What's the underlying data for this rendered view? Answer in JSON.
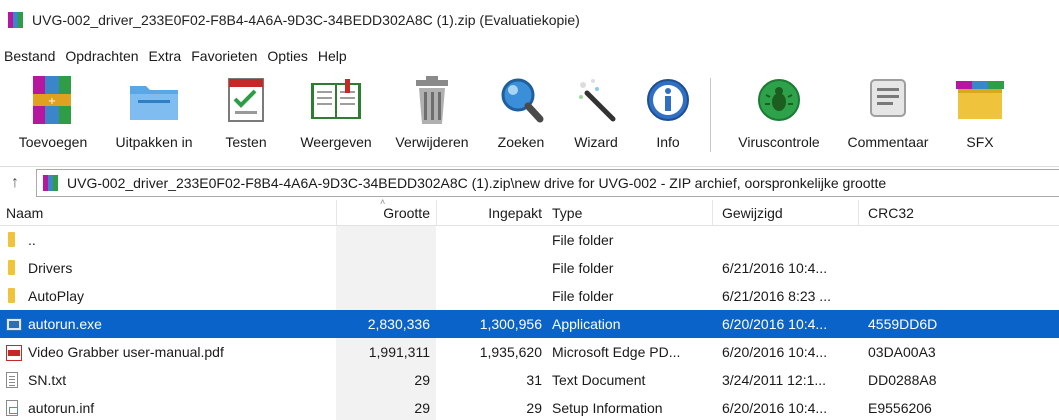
{
  "window": {
    "title": "UVG-002_driver_233E0F02-F8B4-4A6A-9D3C-34BEDD302A8C (1).zip (Evaluatiekopie)",
    "app_icon": "winrar-books-icon"
  },
  "menu": [
    "Bestand",
    "Opdrachten",
    "Extra",
    "Favorieten",
    "Opties",
    "Help"
  ],
  "toolbar": [
    {
      "label": "Toevoegen",
      "icon": "add-archive-icon"
    },
    {
      "label": "Uitpakken in",
      "icon": "extract-folder-icon"
    },
    {
      "label": "Testen",
      "icon": "test-checklist-icon"
    },
    {
      "label": "Weergeven",
      "icon": "view-book-icon"
    },
    {
      "label": "Verwijderen",
      "icon": "trash-bin-icon"
    },
    {
      "label": "Zoeken",
      "icon": "magnifier-icon"
    },
    {
      "label": "Wizard",
      "icon": "magic-wand-icon"
    },
    {
      "label": "Info",
      "icon": "info-icon"
    },
    {
      "label": "Viruscontrole",
      "icon": "virus-scan-icon"
    },
    {
      "label": "Commentaar",
      "icon": "comment-icon"
    },
    {
      "label": "SFX",
      "icon": "sfx-icon"
    }
  ],
  "address": {
    "up_icon": "up-arrow-icon",
    "path": "UVG-002_driver_233E0F02-F8B4-4A6A-9D3C-34BEDD302A8C (1).zip\\new drive for UVG-002 - ZIP archief, oorspronkelijke grootte"
  },
  "columns": {
    "name": "Naam",
    "size": "Grootte",
    "packed": "Ingepakt",
    "type": "Type",
    "modified": "Gewijzigd",
    "crc": "CRC32"
  },
  "files": [
    {
      "name": "..",
      "size": "",
      "packed": "",
      "type": "File folder",
      "modified": "",
      "crc": "",
      "icon": "folder-icon",
      "selected": false
    },
    {
      "name": "Drivers",
      "size": "",
      "packed": "",
      "type": "File folder",
      "modified": "6/21/2016 10:4...",
      "crc": "",
      "icon": "folder-icon",
      "selected": false
    },
    {
      "name": "AutoPlay",
      "size": "",
      "packed": "",
      "type": "File folder",
      "modified": "6/21/2016 8:23 ...",
      "crc": "",
      "icon": "folder-icon",
      "selected": false
    },
    {
      "name": "autorun.exe",
      "size": "2,830,336",
      "packed": "1,300,956",
      "type": "Application",
      "modified": "6/20/2016 10:4...",
      "crc": "4559DD6D",
      "icon": "exe-icon",
      "selected": true
    },
    {
      "name": "Video Grabber user-manual.pdf",
      "size": "1,991,311",
      "packed": "1,935,620",
      "type": "Microsoft Edge PD...",
      "modified": "6/20/2016 10:4...",
      "crc": "03DA00A3",
      "icon": "pdf-icon",
      "selected": false
    },
    {
      "name": "SN.txt",
      "size": "29",
      "packed": "31",
      "type": "Text Document",
      "modified": "3/24/2011 12:1...",
      "crc": "DD0288A8",
      "icon": "txt-icon",
      "selected": false
    },
    {
      "name": "autorun.inf",
      "size": "29",
      "packed": "29",
      "type": "Setup Information",
      "modified": "6/20/2016 10:4...",
      "crc": "E9556206",
      "icon": "inf-icon",
      "selected": false
    }
  ]
}
